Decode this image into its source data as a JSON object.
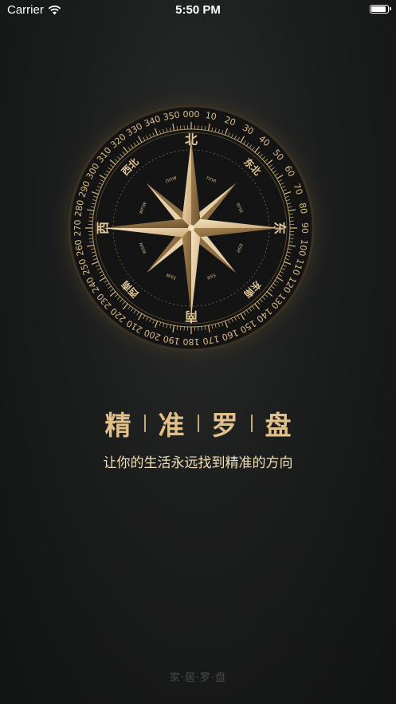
{
  "status_bar": {
    "carrier": "Carrier",
    "time": "5:50 PM",
    "battery_level": 1.0
  },
  "compass": {
    "directions": {
      "north": "北",
      "south": "南",
      "east": "东",
      "west": "西",
      "northeast": "东北",
      "northwest": "西北",
      "southeast": "东南",
      "southwest": "西南"
    },
    "inner_labels": {
      "nne": "nne",
      "nnw": "nnw",
      "ene": "ene",
      "wnw": "wnw",
      "ese": "ese",
      "wsw": "wsw",
      "sse": "sse",
      "ssw": "ssw"
    },
    "degree_labels": [
      "000",
      "10",
      "20",
      "30",
      "40",
      "50",
      "60",
      "70",
      "80",
      "90",
      "100",
      "110",
      "120",
      "130",
      "140",
      "150",
      "160",
      "170",
      "180",
      "190",
      "200",
      "210",
      "220",
      "230",
      "240",
      "250",
      "260",
      "270",
      "280",
      "290",
      "300",
      "310",
      "320",
      "330",
      "340",
      "350"
    ],
    "colors": {
      "gold": "#d9bb8a",
      "dark": "#151515"
    }
  },
  "headline": {
    "chars": [
      "精",
      "准",
      "罗",
      "盘"
    ]
  },
  "tagline": "让你的生活永远找到精准的方向",
  "footer": "家·居·罗·盘"
}
